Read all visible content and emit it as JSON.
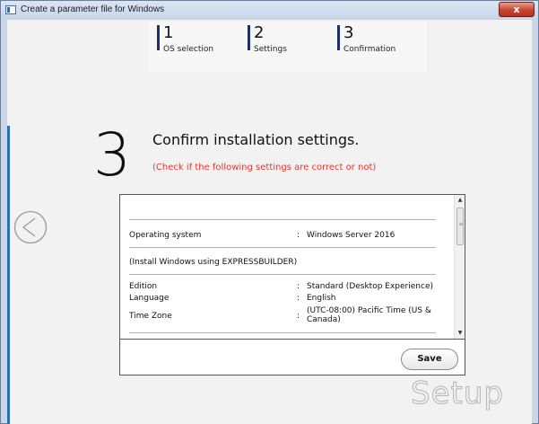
{
  "window": {
    "title": "Create a parameter file for Windows",
    "close_label": "x"
  },
  "steps": [
    {
      "number": "1",
      "label": "OS selection"
    },
    {
      "number": "2",
      "label": "Settings"
    },
    {
      "number": "3",
      "label": "Confirmation"
    }
  ],
  "page": {
    "big_number": "3",
    "heading": "Confirm installation settings.",
    "subheading": "(Check if the following settings are correct or not)"
  },
  "settings": {
    "os_label": "Operating system",
    "os_value": "Windows Server 2016",
    "install_note": "(Install Windows using EXPRESSBUILDER)",
    "edition_label": "Edition",
    "edition_value": "Standard (Desktop Experience)",
    "language_label": "Language",
    "language_value": "English",
    "timezone_label": "Time Zone",
    "timezone_value": "(UTC-08:00) Pacific Time (US & Canada)",
    "colon": ":"
  },
  "buttons": {
    "save": "Save"
  },
  "logo": "Setup",
  "icons": {
    "prev": "chevron-left-circle-icon",
    "app": "window-app-icon"
  }
}
